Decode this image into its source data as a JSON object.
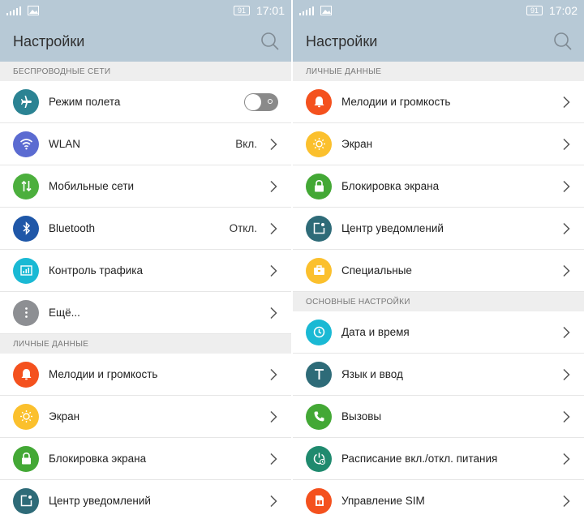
{
  "left": {
    "status": {
      "battery": "91",
      "time": "17:01"
    },
    "title": "Настройки",
    "sections": [
      {
        "header": "БЕСПРОВОДНЫЕ СЕТИ",
        "items": [
          {
            "label": "Режим полета",
            "icon": "airplane-icon",
            "color": "#2b8393",
            "toggle": true
          },
          {
            "label": "WLAN",
            "value": "Вкл.",
            "icon": "wifi-icon",
            "color": "#5b6bd1"
          },
          {
            "label": "Мобильные сети",
            "icon": "mobile-data-icon",
            "color": "#4caf3d"
          },
          {
            "label": "Bluetooth",
            "value": "Откл.",
            "icon": "bluetooth-icon",
            "color": "#1f57a8"
          },
          {
            "label": "Контроль трафика",
            "icon": "traffic-icon",
            "color": "#1ab9d4"
          },
          {
            "label": "Ещё...",
            "icon": "more-icon",
            "color": "#8d8f93"
          }
        ]
      },
      {
        "header": "ЛИЧНЫЕ ДАННЫЕ",
        "items": [
          {
            "label": "Мелодии и громкость",
            "icon": "bell-icon",
            "color": "#f4511e"
          },
          {
            "label": "Экран",
            "icon": "brightness-icon",
            "color": "#fbc02d"
          },
          {
            "label": "Блокировка экрана",
            "icon": "lock-icon",
            "color": "#43a835"
          },
          {
            "label": "Центр уведомлений",
            "icon": "notification-icon",
            "color": "#2e6b78"
          }
        ]
      }
    ]
  },
  "right": {
    "status": {
      "battery": "91",
      "time": "17:02"
    },
    "title": "Настройки",
    "sections": [
      {
        "header": "ЛИЧНЫЕ ДАННЫЕ",
        "items": [
          {
            "label": "Мелодии и громкость",
            "icon": "bell-icon",
            "color": "#f4511e"
          },
          {
            "label": "Экран",
            "icon": "brightness-icon",
            "color": "#fbc02d"
          },
          {
            "label": "Блокировка экрана",
            "icon": "lock-icon",
            "color": "#43a835"
          },
          {
            "label": "Центр уведомлений",
            "icon": "notification-icon",
            "color": "#2e6b78"
          },
          {
            "label": "Специальные",
            "icon": "toolbox-icon",
            "color": "#fbc02d"
          }
        ]
      },
      {
        "header": "ОСНОВНЫЕ НАСТРОЙКИ",
        "items": [
          {
            "label": "Дата и время",
            "icon": "clock-icon",
            "color": "#1ab9d4"
          },
          {
            "label": "Язык и ввод",
            "icon": "language-icon",
            "color": "#2e6b78"
          },
          {
            "label": "Вызовы",
            "icon": "phone-icon",
            "color": "#43a835"
          },
          {
            "label": "Расписание вкл./откл. питания",
            "icon": "power-schedule-icon",
            "color": "#1f8a6e"
          },
          {
            "label": "Управление SIM",
            "icon": "sim-icon",
            "color": "#f4511e"
          }
        ]
      }
    ]
  }
}
